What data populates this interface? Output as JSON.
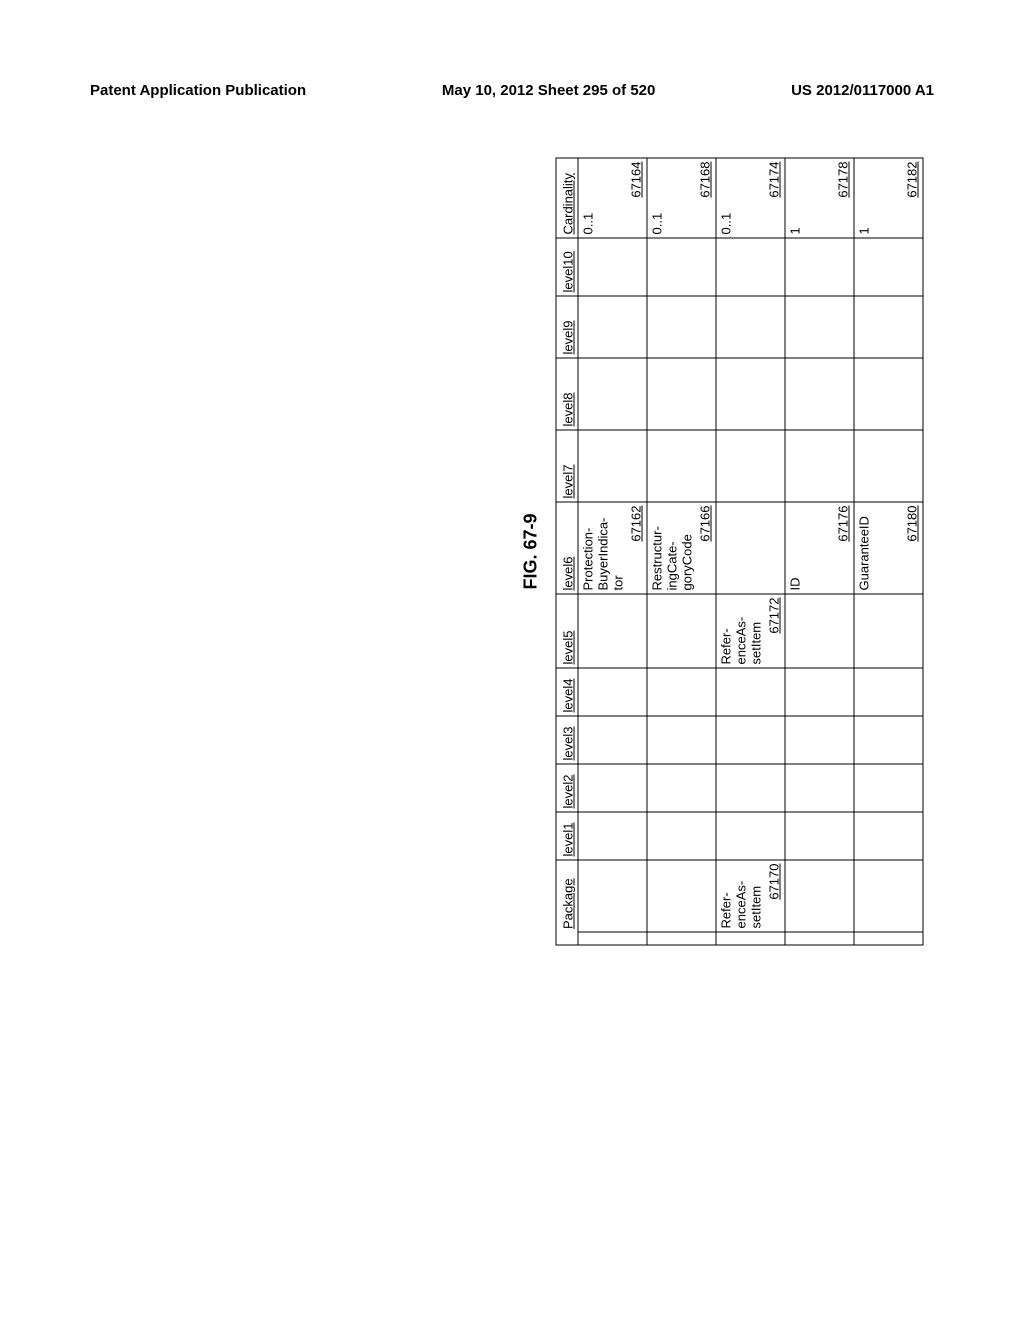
{
  "header": {
    "left": "Patent Application Publication",
    "center": "May 10, 2012  Sheet 295 of 520",
    "right": "US 2012/0117000 A1"
  },
  "figure_label": "FIG. 67-9",
  "columns": [
    "Package",
    "level1",
    "level2",
    "level3",
    "level4",
    "level5",
    "level6",
    "level7",
    "level8",
    "level9",
    "level10",
    "Cardinality"
  ],
  "rows": [
    {
      "package": {
        "text": "",
        "ref": ""
      },
      "level5": {
        "text": "",
        "ref": ""
      },
      "level6": {
        "text": "Protection-BuyerIndica-tor",
        "ref": "67162"
      },
      "card": {
        "text": "0..1",
        "ref": "67164"
      }
    },
    {
      "package": {
        "text": "",
        "ref": ""
      },
      "level5": {
        "text": "",
        "ref": ""
      },
      "level6": {
        "text": "Restructur-ingCate-goryCode",
        "ref": "67166"
      },
      "card": {
        "text": "0..1",
        "ref": "67168"
      }
    },
    {
      "package": {
        "text": "Refer-enceAs-setItem",
        "ref": "67170"
      },
      "level5": {
        "text": "Refer-enceAs-setItem",
        "ref": "67172"
      },
      "level6": {
        "text": "",
        "ref": ""
      },
      "card": {
        "text": "0..1",
        "ref": "67174"
      }
    },
    {
      "package": {
        "text": "",
        "ref": ""
      },
      "level5": {
        "text": "",
        "ref": ""
      },
      "level6": {
        "text": "ID",
        "ref": "67176"
      },
      "card": {
        "text": "1",
        "ref": "67178"
      }
    },
    {
      "package": {
        "text": "",
        "ref": ""
      },
      "level5": {
        "text": "",
        "ref": ""
      },
      "level6": {
        "text": "GuaranteeID",
        "ref": "67180"
      },
      "card": {
        "text": "1",
        "ref": "67182"
      }
    }
  ]
}
